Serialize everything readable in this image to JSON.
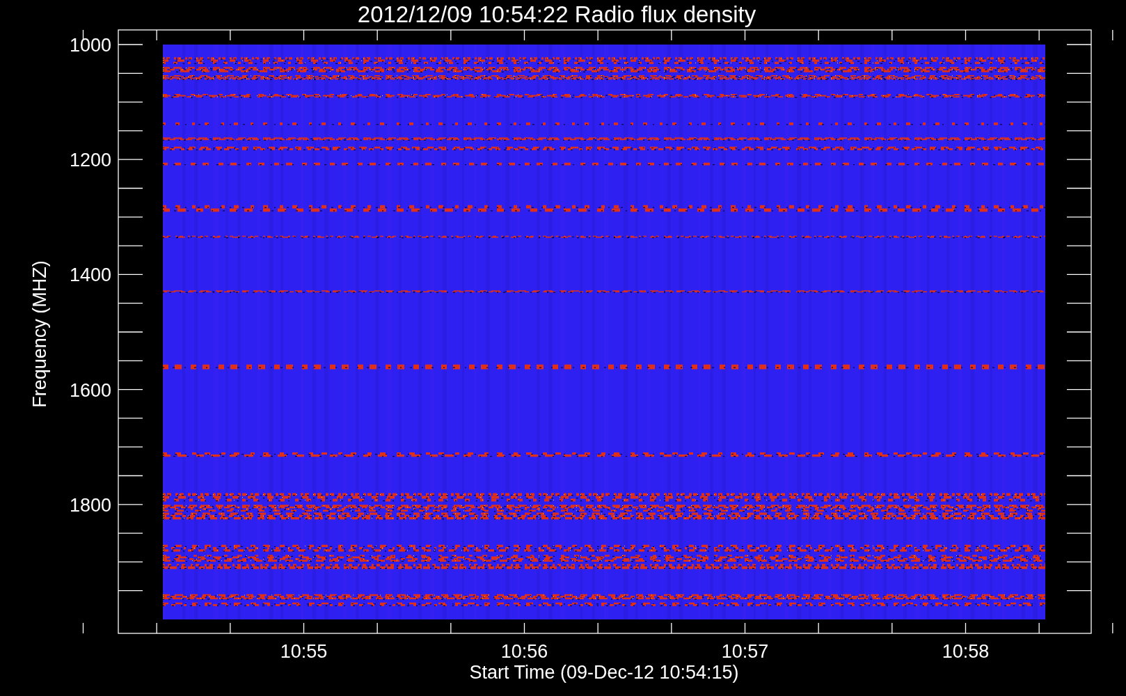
{
  "plot": {
    "title": "2012/12/09 10:54:22 Radio flux density",
    "ylabel": "Frequency (MHZ)",
    "xlabel": "Start Time (09-Dec-12 10:54:15)",
    "yticks": [
      "1000",
      "1200",
      "1400",
      "1600",
      "1800"
    ],
    "xticks": [
      "10:55",
      "10:56",
      "10:57",
      "10:58"
    ]
  }
}
